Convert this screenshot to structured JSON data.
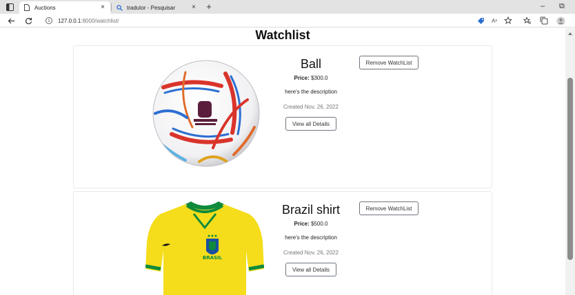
{
  "browser": {
    "tabs": [
      {
        "title": "Auctions",
        "active": true,
        "favicon": "page-icon"
      },
      {
        "title": "tradutor - Pesquisar",
        "active": false,
        "favicon": "search-icon"
      }
    ],
    "new_tab": "+",
    "address": {
      "host": "127.0.0.1",
      "path": ":8000/watchlist/"
    },
    "window_controls": {
      "minimize": "–",
      "maximize": "⧉"
    }
  },
  "page": {
    "title": "Watchlist",
    "remove_label": "Remove WatchList",
    "details_label": "View all Details",
    "price_label": "Price:",
    "items": [
      {
        "title": "Ball",
        "price": "$300.0",
        "description": "here's the description",
        "created": "Created Nov. 26, 2022",
        "image": "soccer-ball"
      },
      {
        "title": "Brazil shirt",
        "price": "$500.0",
        "description": "here's the description",
        "created": "Created Nov. 26, 2022",
        "image": "yellow-jersey",
        "badge_text": "BRASIL"
      }
    ]
  },
  "colors": {
    "ball_accent_red": "#d9342b",
    "ball_accent_blue": "#2c6fd1",
    "jersey_yellow": "#f5dd1c",
    "jersey_green": "#0f8a3c"
  }
}
